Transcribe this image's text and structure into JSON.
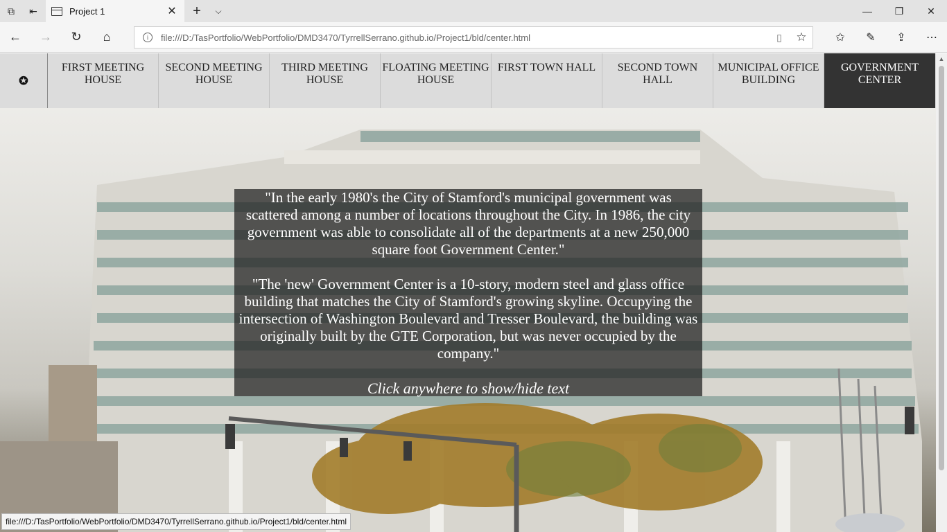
{
  "browser": {
    "tab_title": "Project 1",
    "new_tab_label": "+",
    "url": "file:///D:/TasPortfolio/WebPortfolio/DMD3470/TyrrellSerrano.github.io/Project1/bld/center.html",
    "status_url": "file:///D:/TasPortfolio/WebPortfolio/DMD3470/TyrrellSerrano.github.io/Project1/bld/center.html"
  },
  "site_nav": {
    "items": [
      {
        "label": "FIRST MEETING HOUSE"
      },
      {
        "label": "SECOND MEETING HOUSE"
      },
      {
        "label": "THIRD MEETING HOUSE"
      },
      {
        "label": "FLOATING MEETING HOUSE"
      },
      {
        "label": "FIRST TOWN HALL"
      },
      {
        "label": "SECOND TOWN HALL"
      },
      {
        "label": "MUNICIPAL OFFICE BUILDING"
      },
      {
        "label": "GOVERNMENT CENTER"
      }
    ],
    "active_index": 7
  },
  "panel": {
    "paragraph1": "\"In the early 1980's the City of Stamford's municipal government was scattered among a number of locations throughout the City. In 1986, the city government was able to consolidate all of the departments at a new 250,000 square foot Government Center.\"",
    "paragraph2": "\"The 'new' Government Center is a 10-story, modern steel and glass office building that matches the City of Stamford's growing skyline. Occupying the intersection of Washington Boulevard and Tresser Boulevard, the building was originally built by the GTE Corporation, but was never occupied by the company.\"",
    "hint": "Click anywhere to show/hide text"
  },
  "colors": {
    "nav_bg": "#dcdcdc",
    "nav_active_bg": "#333333",
    "panel_bg": "rgba(30,30,30,0.72)"
  }
}
